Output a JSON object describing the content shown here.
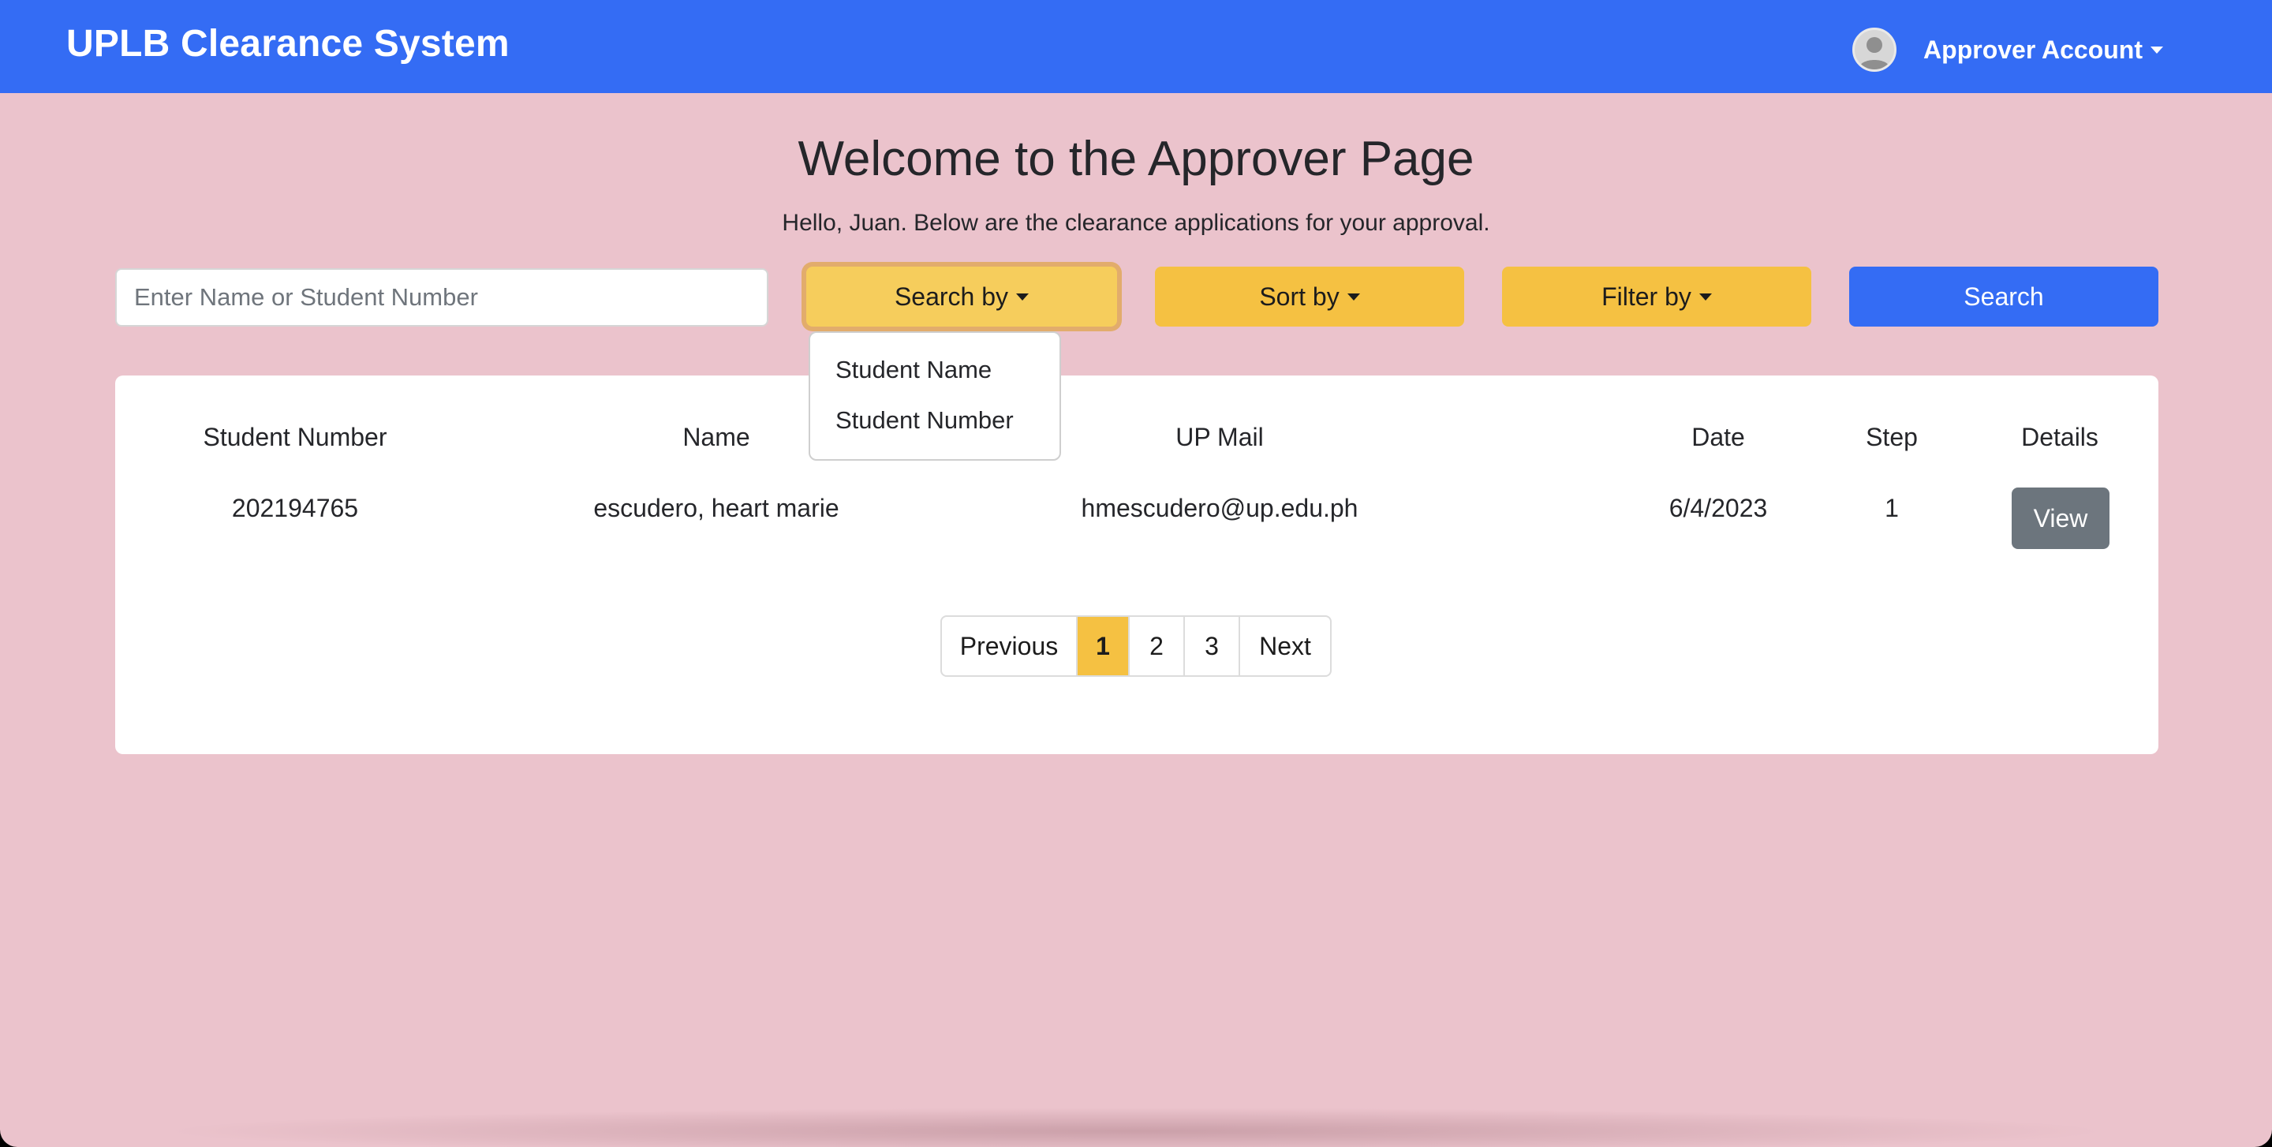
{
  "navbar": {
    "brand": "UPLB Clearance System",
    "account_label": "Approver Account",
    "bg_color": "#346cf4"
  },
  "main": {
    "title": "Welcome to the Approver Page",
    "subtitle": "Hello, Juan. Below are the clearance applications for your approval."
  },
  "toolbar": {
    "search_placeholder": "Enter Name or Student Number",
    "search_value": "",
    "search_by_label": "Search by",
    "sort_by_label": "Sort by",
    "filter_by_label": "Filter by",
    "search_button_label": "Search",
    "accent_yellow": "#f5c142"
  },
  "search_by_menu": {
    "items": [
      "Student Name",
      "Student Number"
    ]
  },
  "table": {
    "headers": [
      "Student Number",
      "Name",
      "UP Mail",
      "Date",
      "Step",
      "Details"
    ],
    "rows": [
      {
        "student_number": "202194765",
        "name": "escudero, heart marie",
        "up_mail": "hmescudero@up.edu.ph",
        "date": "6/4/2023",
        "step": "1",
        "details_label": "View"
      }
    ]
  },
  "pagination": {
    "previous_label": "Previous",
    "pages": [
      "1",
      "2",
      "3"
    ],
    "current_page": "1",
    "next_label": "Next"
  }
}
